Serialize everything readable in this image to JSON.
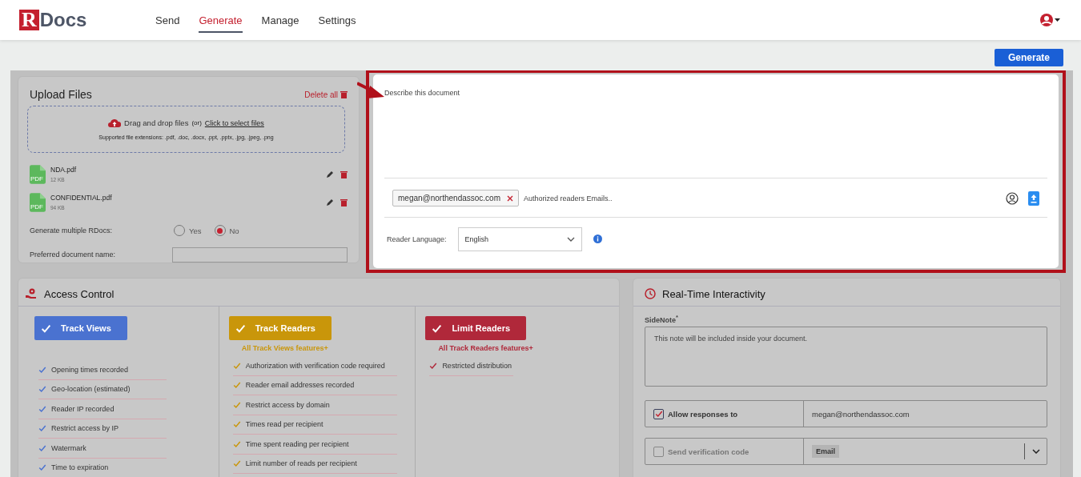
{
  "nav": {
    "brand_r": "R",
    "brand_rest": "Docs",
    "links": [
      {
        "label": "Send",
        "selected": false
      },
      {
        "label": "Generate",
        "selected": true
      },
      {
        "label": "Manage",
        "selected": false
      },
      {
        "label": "Settings",
        "selected": false
      }
    ]
  },
  "generate_button": "Generate",
  "upload": {
    "title": "Upload Files",
    "delete_all": "Delete all",
    "drag_text": "Drag and drop files",
    "or_text": "(or)",
    "select_link": "Click to select files",
    "extensions": "Supported file extensions: .pdf, .doc, .docx, .ppt, .pptx, .jpg, .jpeg, .png",
    "files": [
      {
        "name": "NDA.pdf",
        "size": "12 KB",
        "type": "PDF"
      },
      {
        "name": "CONFIDENTIAL.pdf",
        "size": "94 KB",
        "type": "PDF"
      }
    ],
    "multiple_label": "Generate multiple RDocs:",
    "options": [
      {
        "label": "Yes",
        "selected": false
      },
      {
        "label": "No",
        "selected": true
      }
    ],
    "preferred_label": "Preferred document name:"
  },
  "describe": {
    "placeholder": "Describe this document",
    "emails": [
      "megan@northendassoc.com"
    ],
    "email_placeholder": "Authorized readers Emails..",
    "language_label": "Reader Language:",
    "language": "English"
  },
  "access": {
    "title": "Access Control",
    "tiers": [
      {
        "label": "Track Views",
        "color": "#4a72d0",
        "features": [
          "Opening times recorded",
          "Geo-location (estimated)",
          "Reader IP recorded",
          "Restrict access by IP",
          "Watermark",
          "Time to expiration"
        ]
      },
      {
        "label": "Track Readers",
        "color": "#c9960a",
        "subtitle": "All Track Views features+",
        "features": [
          "Authorization with verification code required",
          "Reader email addresses recorded",
          "Restrict access by domain",
          "Times read per recipient",
          "Time spent reading per recipient",
          "Limit number of reads per recipient"
        ]
      },
      {
        "label": "Limit Readers",
        "color": "#b0283a",
        "subtitle": "All Track Readers features+",
        "features": [
          "Restricted distribution"
        ]
      }
    ]
  },
  "realtime": {
    "title": "Real-Time Interactivity",
    "sidenote_label": "SideNote$^{*}$",
    "sidenote_placeholder": "This note will be included inside your document.",
    "rows": [
      {
        "label": "Allow responses to",
        "checked": true,
        "kind": "text",
        "value": "megan@northendassoc.com"
      },
      {
        "label": "Send verification code",
        "checked": false,
        "kind": "select",
        "value": "Email"
      }
    ]
  }
}
